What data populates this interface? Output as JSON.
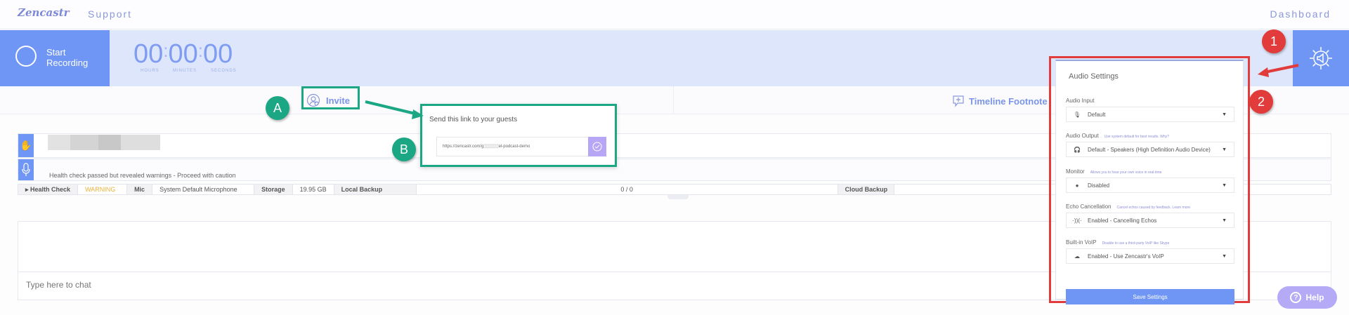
{
  "nav": {
    "logo": "Zencastr",
    "support": "Support",
    "dashboard": "Dashboard"
  },
  "recorder": {
    "start_label": "Start Recording",
    "hours": "00",
    "minutes": "00",
    "seconds": "00",
    "hours_label": "HOURS",
    "minutes_label": "MINUTES",
    "seconds_label": "SECONDS"
  },
  "tabs": {
    "invite": "Invite",
    "footnote": "Timeline Footnote"
  },
  "participant": {
    "health_message": "Health check passed but revealed warnings - Proceed with caution"
  },
  "status": {
    "health_check": "Health Check",
    "warning": "WARNING",
    "mic": "Mic",
    "mic_value": "System Default Microphone",
    "storage": "Storage",
    "storage_value": "19.95 GB",
    "local_backup": "Local Backup",
    "local_value": "0 / 0",
    "cloud_backup": "Cloud Backup"
  },
  "chat": {
    "placeholder": "Type here to chat"
  },
  "invite_popup": {
    "title": "Send this link to your guests",
    "link": "https://zencastr.com/g░░░░░el-podcast-demo"
  },
  "audio_settings": {
    "title": "Audio Settings",
    "fields": [
      {
        "label": "Audio Input",
        "hint": "",
        "value": "Default",
        "icon": "microphone-icon"
      },
      {
        "label": "Audio Output",
        "hint": "Use system default for best results. Why?",
        "value": "Default - Speakers (High Definition Audio Device)",
        "icon": "headphones-icon"
      },
      {
        "label": "Monitor",
        "hint": "Allows you to hear your own voice in real-time",
        "value": "Disabled",
        "icon": "headset-icon"
      },
      {
        "label": "Echo Cancellation",
        "hint": "Cancel echos caused by feedback. Learn more",
        "value": "Enabled - Cancelling Echos",
        "icon": "echo-icon"
      },
      {
        "label": "Built-in VoIP",
        "hint": "Disable to use a third-party VoIP like Skype",
        "value": "Enabled - Use Zencastr's VoIP",
        "icon": "cloud-icon"
      }
    ],
    "save": "Save Settings"
  },
  "help": "Help",
  "annotations": {
    "a": "A",
    "b": "B",
    "one": "1",
    "two": "2"
  },
  "colors": {
    "primary": "#6f95f5",
    "annotation_green": "#1ba784",
    "annotation_red": "#e23b3b",
    "warning": "#e8b13a"
  }
}
